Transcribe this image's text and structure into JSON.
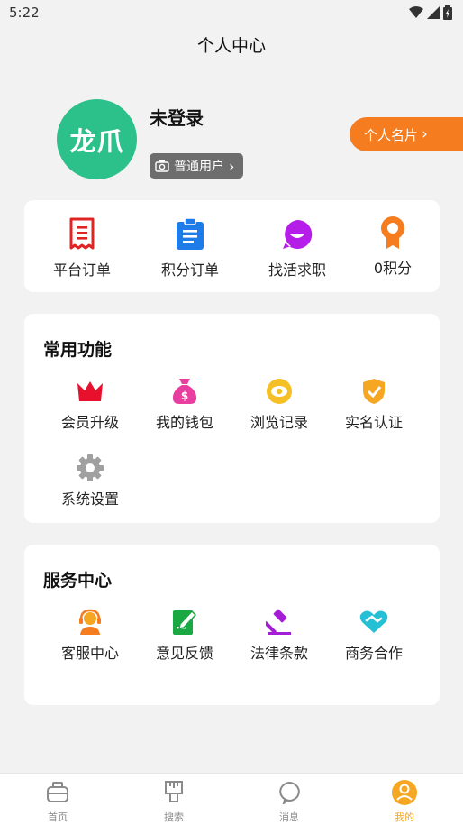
{
  "status_bar": {
    "time": "5:22"
  },
  "header": {
    "title": "个人中心"
  },
  "profile": {
    "avatar_text": "龙爪",
    "name": "未登录",
    "user_type": "普通用户",
    "card_button": "个人名片"
  },
  "quick": [
    {
      "label": "平台订单",
      "icon": "receipt-icon"
    },
    {
      "label": "积分订单",
      "icon": "clipboard-icon"
    },
    {
      "label": "找活求职",
      "icon": "chat-bubble-icon"
    },
    {
      "label": "0积分",
      "icon": "medal-icon"
    }
  ],
  "common": {
    "title": "常用功能",
    "items": [
      {
        "label": "会员升级",
        "icon": "crown-icon"
      },
      {
        "label": "我的钱包",
        "icon": "money-bag-icon"
      },
      {
        "label": "浏览记录",
        "icon": "eye-icon"
      },
      {
        "label": "实名认证",
        "icon": "shield-check-icon"
      },
      {
        "label": "系统设置",
        "icon": "gear-icon"
      }
    ]
  },
  "service": {
    "title": "服务中心",
    "items": [
      {
        "label": "客服中心",
        "icon": "customer-service-icon"
      },
      {
        "label": "意见反馈",
        "icon": "feedback-edit-icon"
      },
      {
        "label": "法律条款",
        "icon": "gavel-icon"
      },
      {
        "label": "商务合作",
        "icon": "handshake-icon"
      }
    ]
  },
  "tabs": [
    {
      "label": "首页",
      "icon": "home-icon"
    },
    {
      "label": "搜索",
      "icon": "search-icon"
    },
    {
      "label": "消息",
      "icon": "message-icon"
    },
    {
      "label": "我的",
      "icon": "profile-icon",
      "active": true
    }
  ],
  "colors": {
    "accent": "#f57c1f",
    "avatar": "#2cc08a",
    "tab_active": "#f5a623"
  }
}
